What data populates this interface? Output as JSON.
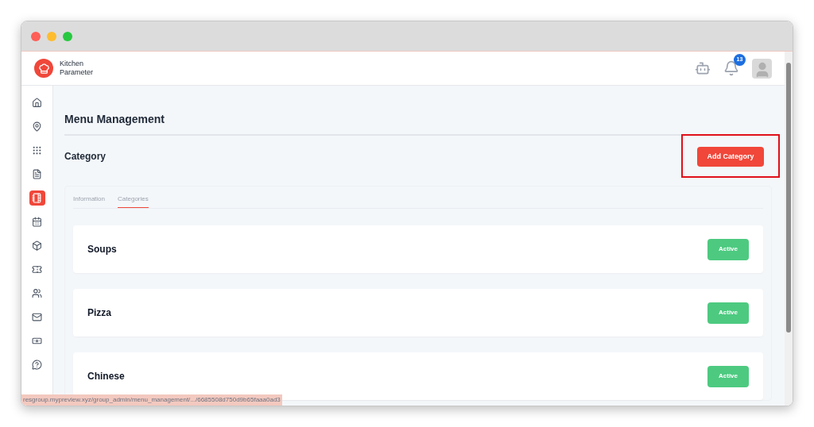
{
  "brand": {
    "line1": "Kitchen",
    "line2": "Parameter"
  },
  "header": {
    "notification_count": "13"
  },
  "sidebar": {
    "items": [
      {
        "kind": "home",
        "selected": false
      },
      {
        "kind": "pin",
        "selected": false
      },
      {
        "kind": "grid",
        "selected": false
      },
      {
        "kind": "doc",
        "selected": false
      },
      {
        "kind": "notebook",
        "selected": true
      },
      {
        "kind": "calendar",
        "selected": false
      },
      {
        "kind": "box",
        "selected": false
      },
      {
        "kind": "ticket",
        "selected": false
      },
      {
        "kind": "users",
        "selected": false
      },
      {
        "kind": "mail",
        "selected": false
      },
      {
        "kind": "cash",
        "selected": false
      },
      {
        "kind": "help",
        "selected": false
      }
    ]
  },
  "page": {
    "title": "Menu Management",
    "section": "Category",
    "add_button": "Add Category"
  },
  "tabs": [
    {
      "label": "Information",
      "selected": false
    },
    {
      "label": "Categories",
      "selected": true
    }
  ],
  "categories": [
    {
      "name": "Soups",
      "status": "Active"
    },
    {
      "name": "Pizza",
      "status": "Active"
    },
    {
      "name": "Chinese",
      "status": "Active"
    }
  ],
  "status_bar": {
    "url": "resgroup.mypreview.xyz/group_admin/menu_management/.../6685508d750d9b65faaa0ad3"
  }
}
